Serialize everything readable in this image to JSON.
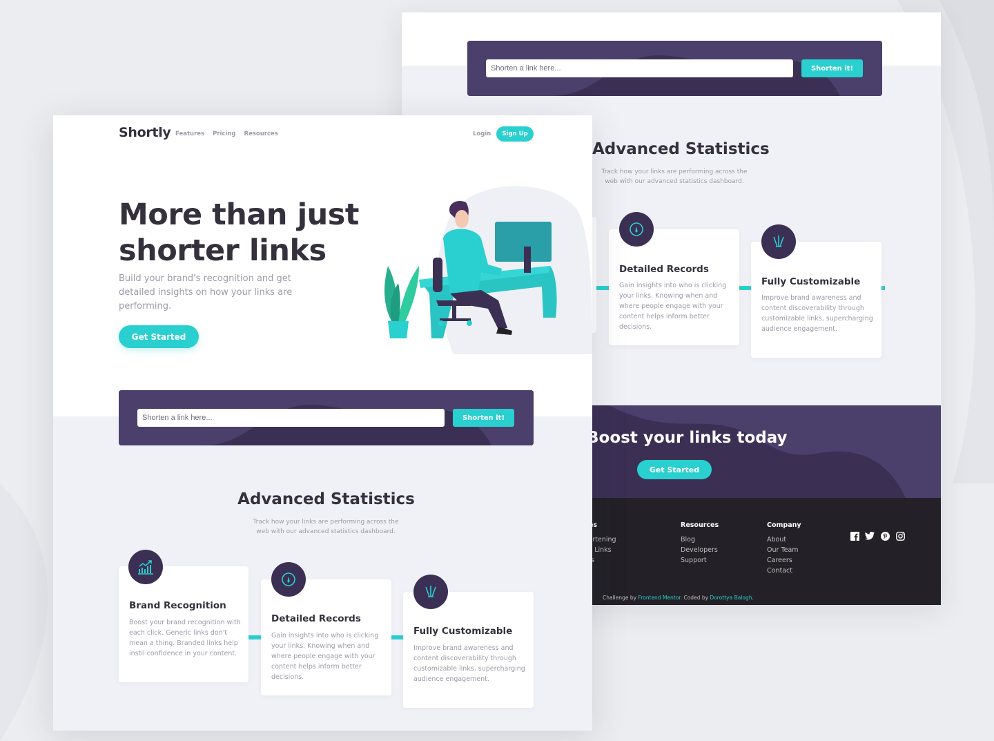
{
  "colors": {
    "cyan": "#2acfcf",
    "dark_violet": "#3b3054",
    "very_dark_violet": "#232127",
    "grayish_violet": "#9e9aa7",
    "very_dark_blue": "#34313d"
  },
  "back": {
    "shortener": {
      "placeholder": "Shorten a link here...",
      "button": "Shorten it!"
    },
    "stats": {
      "title": "Advanced Statistics",
      "subtitle": "Track how your links are performing across the web with our advanced statistics dashboard."
    },
    "cards": [
      {
        "icon": "speedometer-icon",
        "title": "Detailed Records",
        "text": "Gain insights into who is clicking your links. Knowing when and where people engage with your content helps inform better decisions."
      },
      {
        "icon": "pens-icon",
        "title": "Fully Customizable",
        "text": "Improve brand awareness and content discoverability through customizable links, supercharging audience engagement."
      }
    ],
    "boost": {
      "title": "Boost your links today",
      "button": "Get Started"
    },
    "footer": {
      "columns": [
        {
          "title": "Features",
          "links": [
            "Link Shortening",
            "Branded Links",
            "Analytics"
          ]
        },
        {
          "title": "Resources",
          "links": [
            "Blog",
            "Developers",
            "Support"
          ]
        },
        {
          "title": "Company",
          "links": [
            "About",
            "Our Team",
            "Careers",
            "Contact"
          ]
        }
      ],
      "social": [
        "facebook-icon",
        "twitter-icon",
        "pinterest-icon",
        "instagram-icon"
      ],
      "credit": {
        "prefix": "Challenge by ",
        "link1": "Frontend Mentor",
        "middle": ". Coded by ",
        "link2": "Dorottya Balogh",
        "suffix": "."
      }
    }
  },
  "front": {
    "header": {
      "logo": "Shortly",
      "nav": [
        "Features",
        "Pricing",
        "Resources"
      ],
      "login": "Login",
      "signup": "Sign Up"
    },
    "hero": {
      "title_line1": "More than just",
      "title_line2": "shorter links",
      "subtitle": "Build your brand's recognition and get detailed insights on how your links are performing.",
      "button": "Get Started"
    },
    "shortener": {
      "placeholder": "Shorten a link here...",
      "button": "Shorten it!"
    },
    "stats": {
      "title": "Advanced Statistics",
      "subtitle": "Track how your links are performing across the web with our advanced statistics dashboard."
    },
    "cards": [
      {
        "icon": "chart-icon",
        "title": "Brand Recognition",
        "text": "Boost your brand recognition with each click. Generic links don't mean a thing. Branded links help instil confidence in your content."
      },
      {
        "icon": "speedometer-icon",
        "title": "Detailed Records",
        "text": "Gain insights into who is clicking your links. Knowing when and where people engage with your content helps inform better decisions."
      },
      {
        "icon": "pens-icon",
        "title": "Fully Customizable",
        "text": "Improve brand awareness and content discoverability through customizable links, supercharging audience engagement."
      }
    ]
  }
}
